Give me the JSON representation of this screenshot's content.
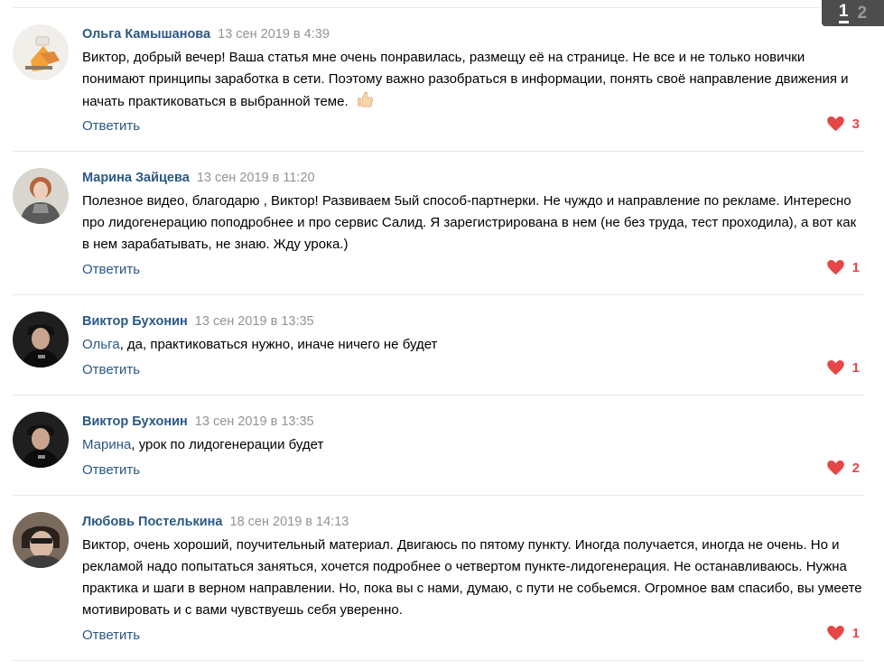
{
  "pager": {
    "current": "1",
    "next": "2"
  },
  "reply_label": "Ответить",
  "colors": {
    "author": "#2a5885",
    "date": "#939393",
    "like": "#e64646",
    "separator": "#e7e8ec"
  },
  "comments": [
    {
      "author": "Ольга Камышанова",
      "date": "13 сен 2019 в 4:39",
      "text": "Виктор, добрый вечер! Ваша статья мне очень понравилась, размещу её на странице. Не все и не только новички понимают принципы заработка в сети. Поэтому важно разобраться в информации, понять своё направление движения и начать практиковаться в выбранной теме.",
      "emoji": "thumbs-up-icon",
      "likes": "3"
    },
    {
      "author": "Марина Зайцева",
      "date": "13 сен 2019 в 11:20",
      "text": "Полезное видео, благодарю , Виктор! Развиваем 5ый способ-партнерки. Не чуждо и направление по рекламе. Интересно про лидогенерацию поподробнее и про сервис Салид. Я зарегистрирована в нем (не без труда, тест проходила), а вот как в нем зарабатывать, не знаю. Жду урока.)",
      "likes": "1"
    },
    {
      "author": "Виктор Бухонин",
      "date": "13 сен 2019 в 13:35",
      "mention": "Ольга",
      "text": ", да, практиковаться нужно, иначе ничего не будет",
      "likes": "1"
    },
    {
      "author": "Виктор Бухонин",
      "date": "13 сен 2019 в 13:35",
      "mention": "Марина",
      "text": ", урок по лидогенерации будет",
      "likes": "2"
    },
    {
      "author": "Любовь Постелькина",
      "date": "18 сен 2019 в 14:13",
      "text": "Виктор, очень хороший, поучительный материал. Двигаюсь по пятому пункту. Иногда получается, иногда не очень. Но и рекламой надо попытаться заняться, хочется подробнее о четвертом пункте-лидогенерация. Не останавливаюсь. Нужна практика и шаги в верном направлении. Но, пока вы с нами, думаю, с пути не собьемся. Огромное вам спасибо, вы умеете мотивировать и с вами чувствуешь себя уверенно.",
      "likes": "1"
    }
  ]
}
